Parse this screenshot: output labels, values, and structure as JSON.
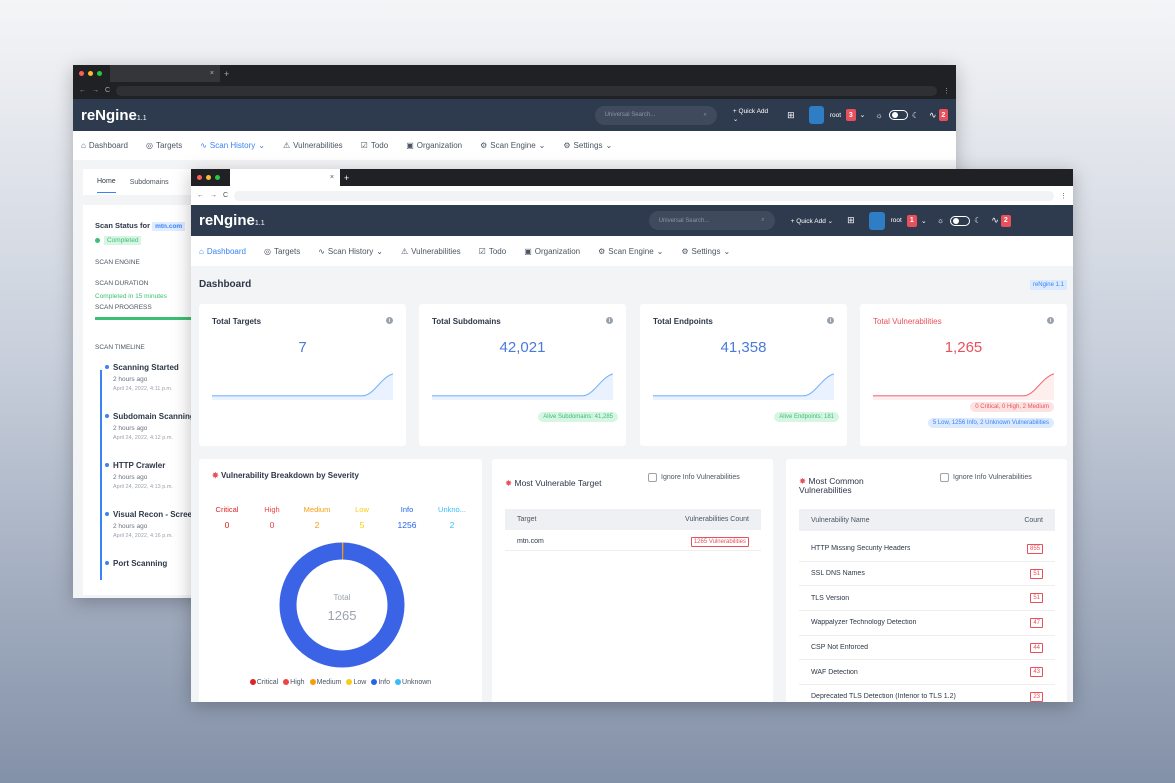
{
  "colors": {
    "accent": "#3b82f6",
    "navbar": "#2e3b4e",
    "danger": "#e8515c",
    "success": "#3bbf73"
  },
  "back_window": {
    "brand": "reNgine",
    "version": "1.1",
    "search_placeholder": "Universal Search...",
    "quick_add": "+ Quick Add",
    "user": "root",
    "notif_count": "3",
    "alert_count": "2",
    "nav": [
      "Dashboard",
      "Targets",
      "Scan History",
      "Vulnerabilities",
      "Todo",
      "Organization",
      "Scan Engine",
      "Settings"
    ],
    "subtabs": [
      "Home",
      "Subdomains"
    ],
    "scan_status_label": "Scan Status for",
    "scan_target": "mtn.com",
    "status": "Completed",
    "scan_engine_label": "SCAN ENGINE",
    "scan_duration_label": "SCAN DURATION",
    "scan_duration_value": "Completed in 15 minutes",
    "scan_progress_label": "SCAN PROGRESS",
    "timeline_label": "SCAN TIMELINE",
    "timeline": [
      {
        "title": "Scanning Started",
        "ago": "2 hours ago",
        "time": "April 24, 2022, 4:11 p.m."
      },
      {
        "title": "Subdomain Scanning",
        "ago": "2 hours ago",
        "time": "April 24, 2022, 4:12 p.m."
      },
      {
        "title": "HTTP Crawler",
        "ago": "2 hours ago",
        "time": "April 24, 2022, 4:13 p.m."
      },
      {
        "title": "Visual Recon - Scree",
        "ago": "2 hours ago",
        "time": "April 24, 2022, 4:16 p.m."
      },
      {
        "title": "Port Scanning",
        "ago": "",
        "time": ""
      }
    ]
  },
  "front_window": {
    "brand": "reNgine",
    "version": "1.1",
    "search_placeholder": "Universal Search...",
    "quick_add": "+ Quick Add",
    "user": "root",
    "notif_count": "1",
    "alert_count": "2",
    "nav": [
      "Dashboard",
      "Targets",
      "Scan History",
      "Vulnerabilities",
      "Todo",
      "Organization",
      "Scan Engine",
      "Settings"
    ],
    "page_title": "Dashboard",
    "version_badge": "reNgine 1.1",
    "stats": [
      {
        "title": "Total Targets",
        "value": "7",
        "color": "#4b7bd8"
      },
      {
        "title": "Total Subdomains",
        "value": "42,021",
        "color": "#4b7bd8",
        "pill": "Alive Subdomains: 41,285"
      },
      {
        "title": "Total Endpoints",
        "value": "41,358",
        "color": "#4b7bd8",
        "pill": "Alive Endpoints: 181"
      },
      {
        "title": "Total Vulnerabilities",
        "value": "1,265",
        "color": "#e8515c",
        "pill": "0 Critical, 0 High, 2 Medium",
        "pill2": "5 Low, 1256 Info, 2 Unknown Vulnerabilities"
      }
    ],
    "breakdown": {
      "title": "Vulnerability Breakdown by Severity",
      "levels": [
        {
          "label": "Critical",
          "value": "0",
          "color": "#dc2626"
        },
        {
          "label": "High",
          "value": "0",
          "color": "#ef4444"
        },
        {
          "label": "Medium",
          "value": "2",
          "color": "#f59e0b"
        },
        {
          "label": "Low",
          "value": "5",
          "color": "#facc15"
        },
        {
          "label": "Info",
          "value": "1256",
          "color": "#2563eb"
        },
        {
          "label": "Unkno...",
          "value": "2",
          "color": "#38bdf8"
        }
      ],
      "donut_label": "Total",
      "donut_value": "1265",
      "legend": [
        "Critical",
        "High",
        "Medium",
        "Low",
        "Info",
        "Unknown"
      ]
    },
    "vuln_target": {
      "title": "Most Vulnerable Target",
      "checkbox": "Ignore Info Vulnerabilities",
      "headers": [
        "Target",
        "Vulnerabilities Count"
      ],
      "rows": [
        {
          "target": "mtn.com",
          "count": "1265 Vulnerabilities"
        }
      ]
    },
    "common": {
      "title": "Most Common Vulnerabilities",
      "checkbox": "Ignore Info Vulnerabilities",
      "headers": [
        "Vulnerability Name",
        "Count"
      ],
      "rows": [
        {
          "name": "HTTP Missing Security Headers",
          "count": "855"
        },
        {
          "name": "SSL DNS Names",
          "count": "51"
        },
        {
          "name": "TLS Version",
          "count": "51"
        },
        {
          "name": "Wappalyzer Technology Detection",
          "count": "47"
        },
        {
          "name": "CSP Not Enforced",
          "count": "44"
        },
        {
          "name": "WAF Detection",
          "count": "43"
        },
        {
          "name": "Deprecated TLS Detection (Inferior to TLS 1.2)",
          "count": "23"
        }
      ]
    }
  }
}
